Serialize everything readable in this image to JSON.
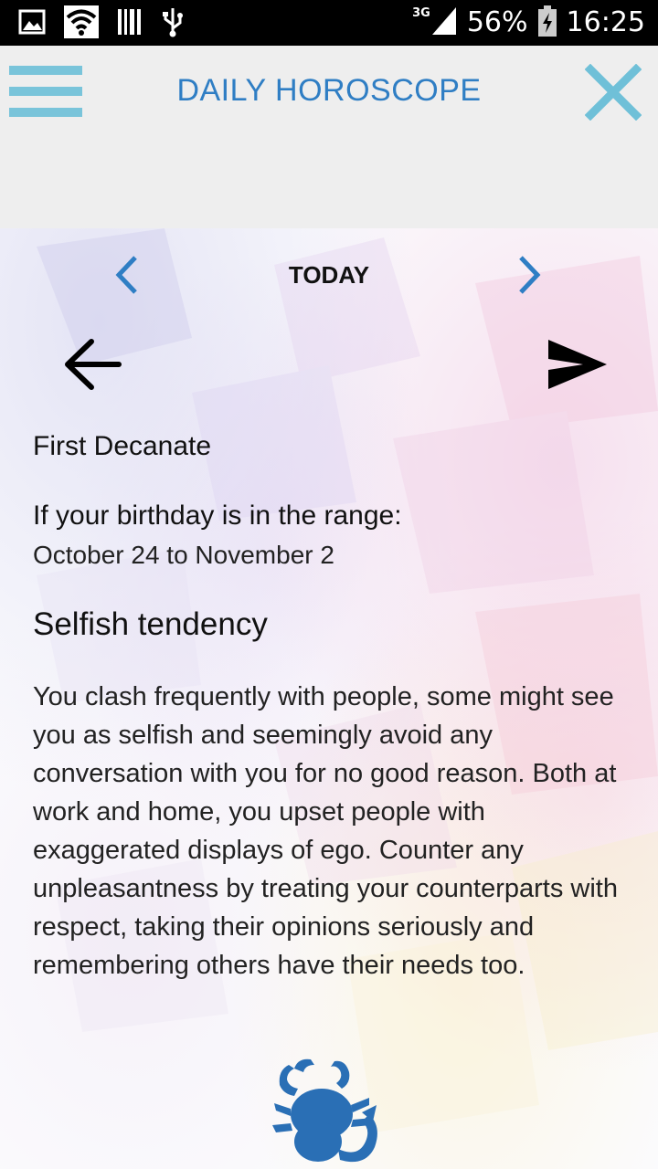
{
  "status_bar": {
    "network": "3G",
    "battery_percent": "56%",
    "time": "16:25",
    "icons": [
      "image-icon",
      "wifi-icon",
      "barcode-icon",
      "usb-icon",
      "signal-icon",
      "battery-icon"
    ]
  },
  "header": {
    "title": "DAILY HOROSCOPE",
    "menu_icon": "hamburger-menu-icon",
    "close_icon": "close-icon"
  },
  "day_nav": {
    "label": "TODAY",
    "prev_icon": "chevron-left-icon",
    "next_icon": "chevron-right-icon"
  },
  "actions": {
    "back_icon": "arrow-left-icon",
    "share_icon": "send-icon"
  },
  "horoscope": {
    "decanate": "First Decanate",
    "range_label": "If your birthday is in the range:",
    "range_value": "October 24 to November 2",
    "headline": "Selfish tendency",
    "body": "You clash frequently with people, some might see you as selfish and seemingly avoid any conversation with you for no good reason. Both at work and home, you upset people with exaggerated displays of ego. Counter any unpleasantness by treating your counterparts with respect, taking their opinions seriously and remembering others have their needs too."
  },
  "sign_icon": "scorpio-icon",
  "colors": {
    "accent_blue": "#2f7ec4",
    "menu_blue": "#79c4da",
    "header_bg": "#eeeeee",
    "scorpio_blue": "#2a6fb5"
  }
}
